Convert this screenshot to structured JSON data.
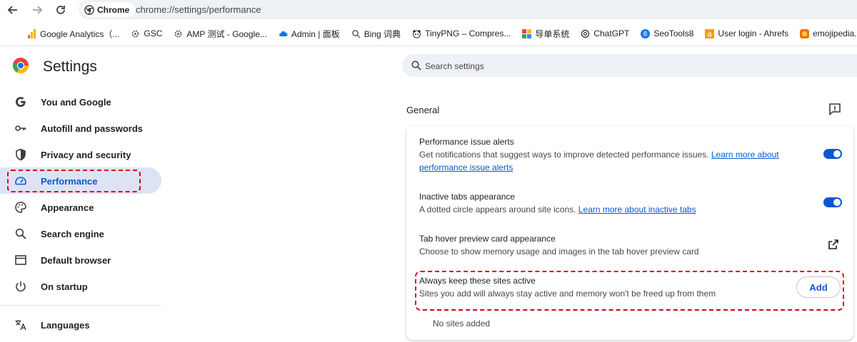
{
  "browser": {
    "chip_label": "Chrome",
    "url": "chrome://settings/performance"
  },
  "bookmarks": [
    {
      "label": "Google Analytics（...",
      "icon": "analytics-icon",
      "color": "#f9ab00"
    },
    {
      "label": "GSC",
      "icon": "gear-icon",
      "color": "#5f6368"
    },
    {
      "label": "AMP 测试 - Google...",
      "icon": "gear-icon",
      "color": "#5f6368"
    },
    {
      "label": "Admin | 面板",
      "icon": "cloud-icon",
      "color": "#1a73e8"
    },
    {
      "label": "Bing 词典",
      "icon": "search-icon",
      "color": "#5f6368"
    },
    {
      "label": "TinyPNG – Compres...",
      "icon": "panda-icon",
      "color": "#2f2f2f"
    },
    {
      "label": "导单系统",
      "icon": "grid-icon",
      "color": "#ea4335"
    },
    {
      "label": "ChatGPT",
      "icon": "openai-icon",
      "color": "#3c3c3c"
    },
    {
      "label": "SeoTools8",
      "icon": "s-badge-icon",
      "color": "#1a73e8"
    },
    {
      "label": "User login - Ahrefs",
      "icon": "a-badge-icon",
      "color": "#f59e0b"
    },
    {
      "label": "emojipedia.org/sea",
      "icon": "emoji-icon",
      "color": "#ff6d00"
    }
  ],
  "settings": {
    "title": "Settings",
    "search_placeholder": "Search settings",
    "nav": [
      {
        "label": "You and Google",
        "icon": "google-g-icon"
      },
      {
        "label": "Autofill and passwords",
        "icon": "key-icon"
      },
      {
        "label": "Privacy and security",
        "icon": "shield-icon"
      },
      {
        "label": "Performance",
        "icon": "speedometer-icon",
        "active": true
      },
      {
        "label": "Appearance",
        "icon": "palette-icon"
      },
      {
        "label": "Search engine",
        "icon": "search-icon"
      },
      {
        "label": "Default browser",
        "icon": "browser-window-icon"
      },
      {
        "label": "On startup",
        "icon": "power-icon"
      },
      {
        "label": "Languages",
        "icon": "translate-icon"
      }
    ]
  },
  "general": {
    "section_title": "General",
    "rows": {
      "alerts": {
        "title": "Performance issue alerts",
        "desc": "Get notifications that suggest ways to improve detected performance issues. ",
        "link": "Learn more about performance issue alerts",
        "enabled": true
      },
      "inactive": {
        "title": "Inactive tabs appearance",
        "desc": "A dotted circle appears around site icons. ",
        "link": "Learn more about inactive tabs",
        "enabled": true
      },
      "hover": {
        "title": "Tab hover preview card appearance",
        "desc": "Choose to show memory usage and images in the tab hover preview card"
      },
      "active_sites": {
        "title": "Always keep these sites active",
        "desc": "Sites you add will always stay active and memory won't be freed up from them",
        "add_label": "Add",
        "empty_text": "No sites added"
      }
    }
  },
  "colors": {
    "accent": "#0b57d0",
    "highlight": "#d8001c",
    "active_nav_bg": "#dde3f5"
  }
}
